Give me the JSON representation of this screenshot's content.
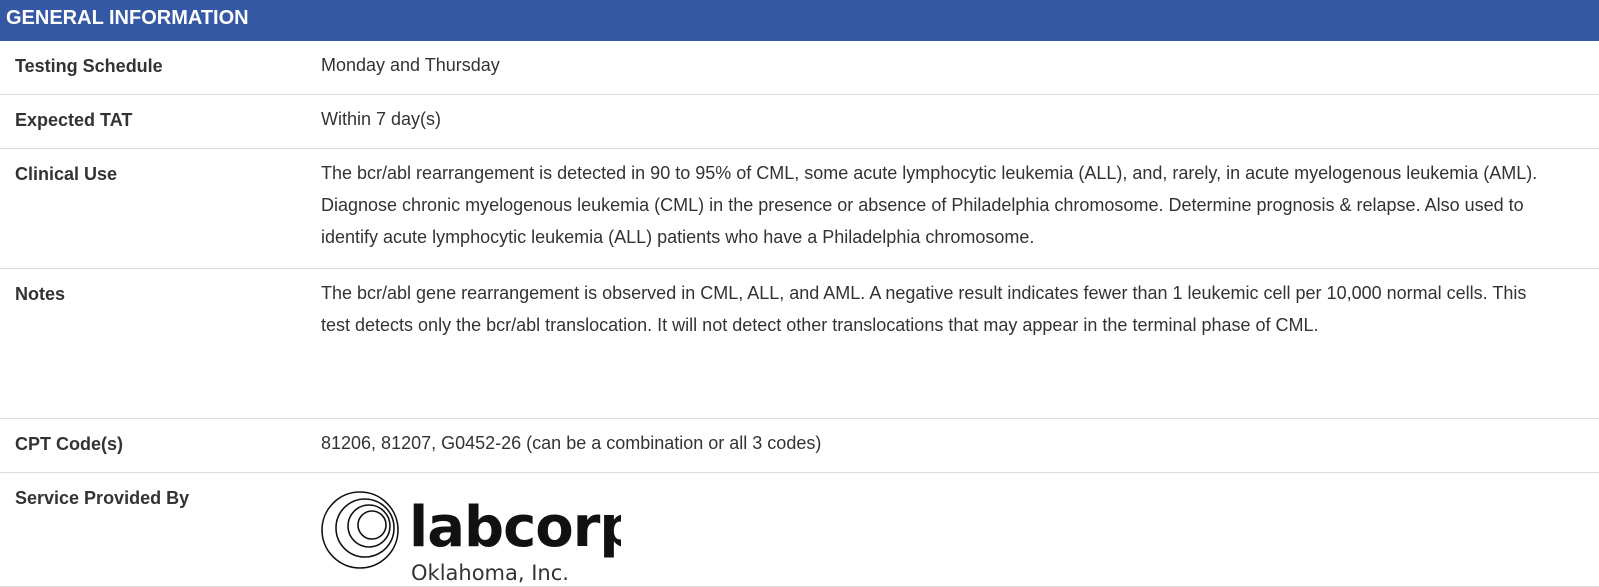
{
  "section_title": "GENERAL INFORMATION",
  "rows": [
    {
      "label": "Testing Schedule",
      "value": "Monday and Thursday"
    },
    {
      "label": "Expected TAT",
      "value": "Within 7 day(s)"
    },
    {
      "label": "Clinical Use",
      "value": "The bcr/abl rearrangement is detected in 90 to 95% of CML, some acute lymphocytic leukemia (ALL), and, rarely, in acute myelogenous leukemia (AML). Diagnose chronic myelogenous leukemia (CML) in the presence or absence of Philadelphia chromosome. Determine prognosis & relapse. Also used to identify acute lymphocytic leukemia (ALL) patients who have a Philadelphia chromosome."
    },
    {
      "label": "Notes",
      "value": "The bcr/abl gene rearrangement is observed in CML, ALL, and AML. A negative result indicates fewer than 1 leukemic cell per 10,000 normal cells. This test detects only the bcr/abl translocation. It will not detect other translocations that may appear in the terminal phase of CML."
    },
    {
      "label": "CPT Code(s)",
      "value": "81206, 81207, G0452-26 (can be a combination or all 3 codes)"
    },
    {
      "label": "Service Provided By"
    }
  ],
  "provider_logo": {
    "icon": "labcorp-logo-icon",
    "name": "labcorp",
    "subtitle": "Oklahoma, Inc.",
    "color": "#111111"
  }
}
